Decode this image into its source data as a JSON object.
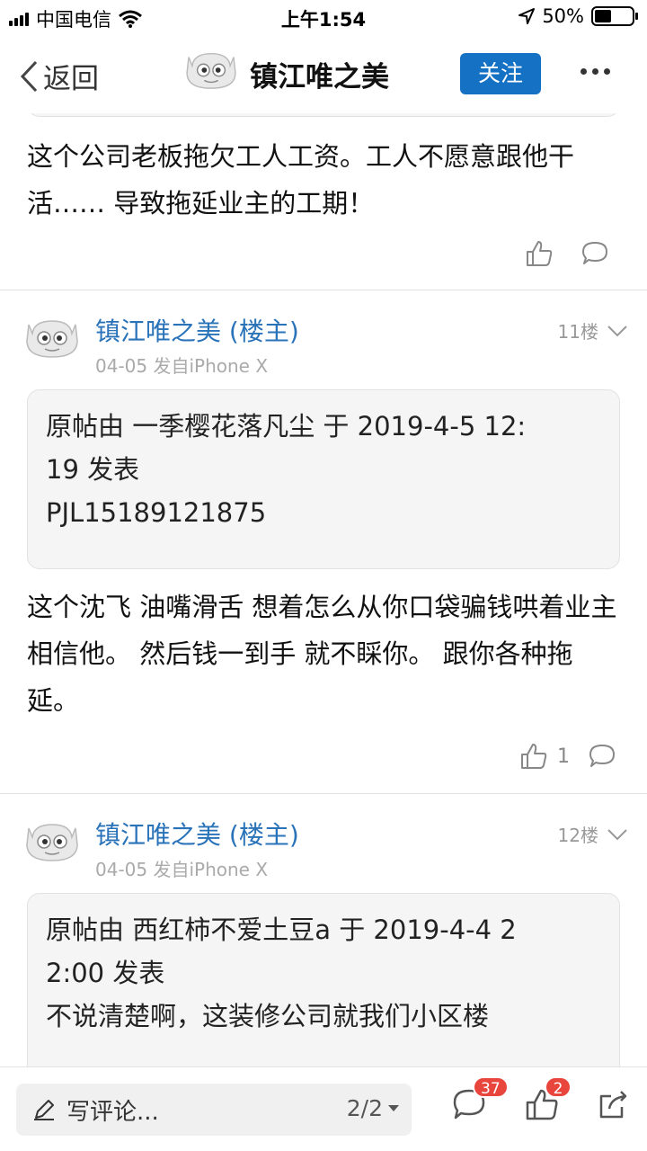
{
  "status_bar": {
    "carrier": "中国电信",
    "time": "上午1:54",
    "battery_percent": "50%",
    "battery_level": 0.5
  },
  "nav": {
    "back_label": "返回",
    "title": "镇江唯之美",
    "follow_label": "关注"
  },
  "previous_post": {
    "body": "这个公司老板拖欠工人工资。工人不愿意跟他干活…… 导致拖延业主的工期！"
  },
  "posts": [
    {
      "author": "镇江唯之美 (楼主)",
      "meta": "04-05 发自iPhone X",
      "floor": "11楼",
      "quote_lines": [
        "原帖由 一季樱花落凡尘 于 2019-4-5 12:",
        "19 发表",
        "PJL15189121875"
      ],
      "body": "这个沈飞 油嘴滑舌 想着怎么从你口袋骗钱哄着业主相信他。 然后钱一到手 就不睬你。 跟你各种拖延。",
      "like_count": "1"
    },
    {
      "author": "镇江唯之美 (楼主)",
      "meta": "04-05 发自iPhone X",
      "floor": "12楼",
      "quote_lines": [
        "原帖由 西红柿不爱土豆a 于 2019-4-4 2",
        "2:00 发表",
        "不说清楚啊，这装修公司就我们小区楼"
      ]
    }
  ],
  "bottom_bar": {
    "comment_placeholder": "写评论...",
    "page_indicator": "2/2",
    "comment_badge": "37",
    "like_badge": "2"
  }
}
